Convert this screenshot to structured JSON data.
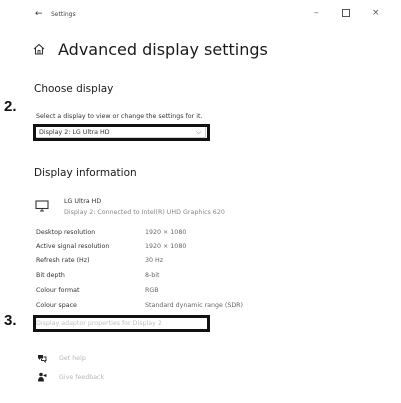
{
  "window": {
    "app_title": "Settings",
    "back_glyph": "←",
    "minimize_glyph": "–",
    "close_glyph": "×"
  },
  "page": {
    "title": "Advanced display settings"
  },
  "choose_display": {
    "heading": "Choose display",
    "instruction": "Select a display to view or change the settings for it.",
    "selected_value": "Display 2: LG Ultra HD",
    "chevron_glyph": "⌵"
  },
  "display_information": {
    "heading": "Display information",
    "monitor_name": "LG Ultra HD",
    "monitor_connection": "Display 2: Connected to Intel(R) UHD Graphics 620",
    "rows": [
      {
        "label": "Desktop resolution",
        "value": "1920 × 1080"
      },
      {
        "label": "Active signal resolution",
        "value": "1920 × 1080"
      },
      {
        "label": "Refresh rate (Hz)",
        "value": "30 Hz"
      },
      {
        "label": "Bit depth",
        "value": "8-bit"
      },
      {
        "label": "Colour format",
        "value": "RGB"
      },
      {
        "label": "Colour space",
        "value": "Standard dynamic range (SDR)"
      }
    ],
    "adapter_link": "Display adaptor properties for Display 2"
  },
  "footer": {
    "get_help": "Get help",
    "give_feedback": "Give feedback"
  },
  "annotations": [
    {
      "number": "2."
    },
    {
      "number": "3."
    }
  ],
  "colors": {
    "annotation_border": "#111111",
    "disabled_link": "#c0c0c0"
  }
}
